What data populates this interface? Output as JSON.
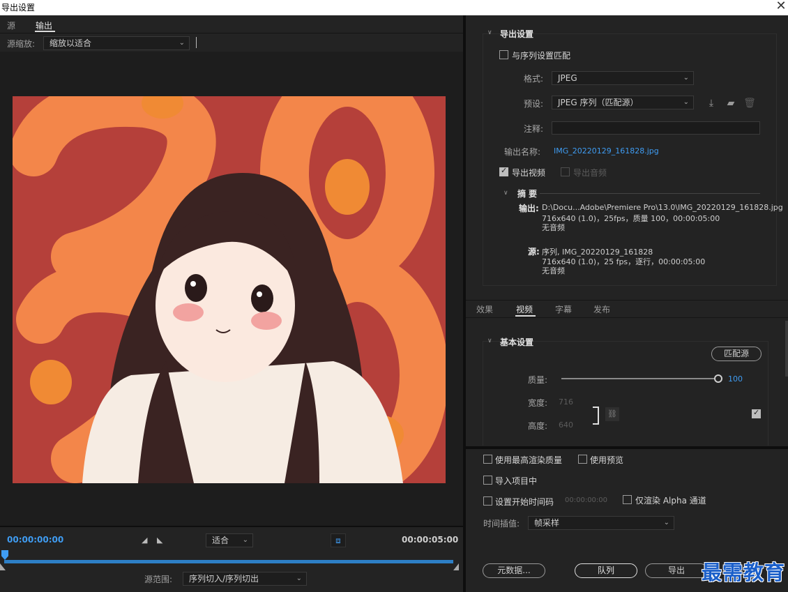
{
  "window": {
    "title": "导出设置"
  },
  "left": {
    "tabs": [
      {
        "label": "源"
      },
      {
        "label": "输出"
      }
    ],
    "scale_label": "源缩放:",
    "scale_value": "缩放以适合",
    "time_start": "00:00:00:00",
    "time_end": "00:00:05:00",
    "fit_value": "适合",
    "range_label": "源范围:",
    "range_value": "序列切入/序列切出"
  },
  "export_settings": {
    "title": "导出设置",
    "match_sequence_label": "与序列设置匹配",
    "format_label": "格式:",
    "format_value": "JPEG",
    "preset_label": "预设:",
    "preset_value": "JPEG 序列（匹配源）",
    "comment_label": "注释:",
    "output_name_label": "输出名称:",
    "output_name_value": "IMG_20220129_161828.jpg",
    "export_video_label": "导出视频",
    "export_audio_label": "导出音频",
    "summary": {
      "title": "摘要",
      "output_label": "输出:",
      "output_path": "D:\\Docu...Adobe\\Premiere Pro\\13.0\\IMG_20220129_161828.jpg",
      "output_line2": "716x640 (1.0)，25fps，质量 100，00:00:05:00",
      "output_line3": "无音频",
      "source_label": "源:",
      "source_line1": "序列, IMG_20220129_161828",
      "source_line2": "716x640 (1.0)，25 fps，逐行，00:00:05:00",
      "source_line3": "无音频"
    }
  },
  "bottom_tabs": [
    {
      "label": "效果"
    },
    {
      "label": "视频"
    },
    {
      "label": "字幕"
    },
    {
      "label": "发布"
    }
  ],
  "basic": {
    "title": "基本设置",
    "match_source_label": "匹配源",
    "quality_label": "质量:",
    "quality_value": "100",
    "quality_fraction": 1.0,
    "width_label": "宽度:",
    "width_value": "716",
    "height_label": "高度:",
    "height_value": "640"
  },
  "options": {
    "max_render_label": "使用最高渲染质量",
    "use_preview_label": "使用预览",
    "import_project_label": "导入项目中",
    "set_start_tc_label": "设置开始时间码",
    "start_tc_value": "00:00:00:00",
    "alpha_only_label": "仅渲染 Alpha 通道",
    "time_interp_label": "时间插值:",
    "time_interp_value": "帧采样"
  },
  "buttons": {
    "metadata": "元数据...",
    "queue": "队列",
    "export": "导出"
  },
  "watermark": "最需教育"
}
